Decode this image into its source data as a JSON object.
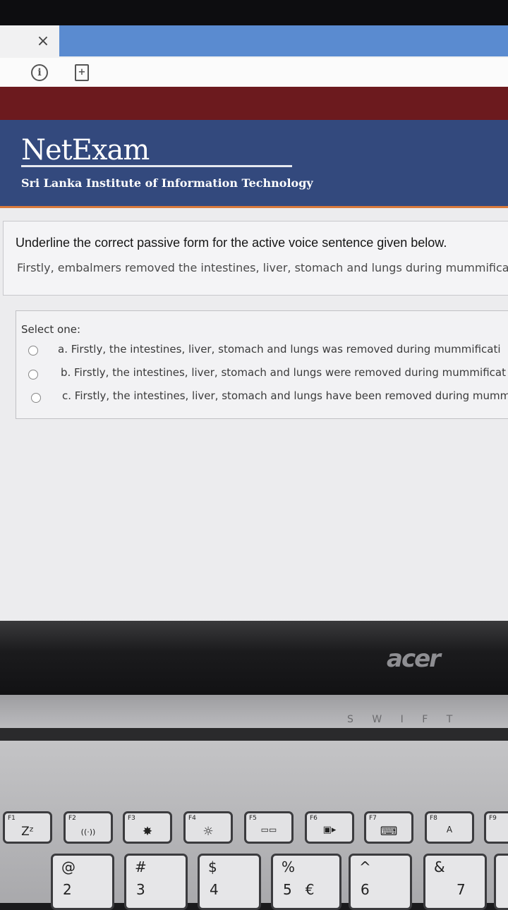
{
  "browser": {
    "close_glyph": "×",
    "info_icon": "info-icon",
    "file_icon": "file-icon"
  },
  "header": {
    "title": "NetExam",
    "subtitle": "Sri Lanka Institute of Information Technology"
  },
  "question": {
    "prompt": "Underline the correct passive form for the active voice sentence given below.",
    "sentence": "Firstly, embalmers removed the intestines, liver, stomach and lungs during mummifica"
  },
  "answers": {
    "select_label": "Select one:",
    "options": [
      "a. Firstly, the intestines, liver, stomach and lungs was removed during mummificati",
      "b. Firstly, the intestines, liver, stomach and lungs were removed during mummificat",
      "c. Firstly, the intestines, liver, stomach and lungs have been removed during mumm"
    ]
  },
  "laptop": {
    "brand": "acer",
    "hinge_text": "S W I F T",
    "fkeys": [
      {
        "label": "F1",
        "symbol": "Zᶻ"
      },
      {
        "label": "F2",
        "symbol": "((·))"
      },
      {
        "label": "F3",
        "symbol": "✸"
      },
      {
        "label": "F4",
        "symbol": "☼"
      },
      {
        "label": "F5",
        "symbol": "▭▭"
      },
      {
        "label": "F6",
        "symbol": "▣▸"
      },
      {
        "label": "F7",
        "symbol": "⌨"
      },
      {
        "label": "F8",
        "symbol": "A"
      },
      {
        "label": "F9",
        "symbol": ""
      }
    ],
    "numkeys": [
      {
        "top": "@",
        "bottom": "2"
      },
      {
        "top": "#",
        "bottom": "3"
      },
      {
        "top": "$",
        "bottom": "4"
      },
      {
        "top": "%",
        "bottom": "5   €"
      },
      {
        "top": "^",
        "bottom": "6"
      },
      {
        "top": "&",
        "bottom": "7"
      }
    ]
  },
  "colors": {
    "header_bg": "#33497d",
    "accent_red": "#6c1a1e",
    "tab_blue": "#5a8bd0"
  }
}
